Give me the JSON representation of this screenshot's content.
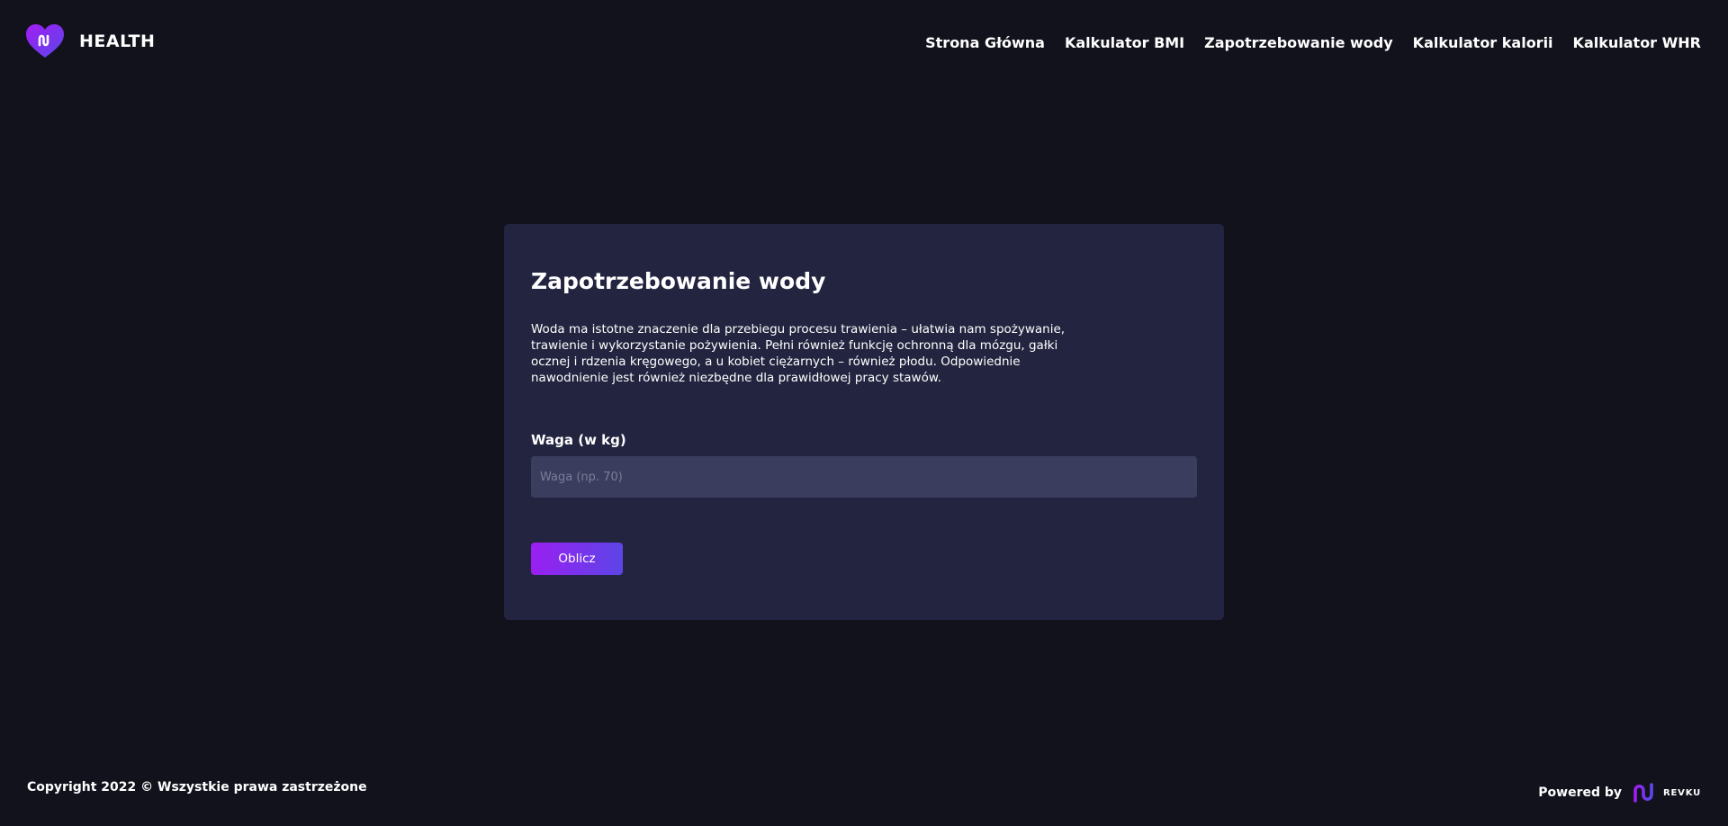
{
  "header": {
    "brand_name": "HEALTH",
    "logo_icon": "heart-logo-icon"
  },
  "nav": {
    "items": [
      {
        "label": "Strona Główna"
      },
      {
        "label": "Kalkulator BMI"
      },
      {
        "label": "Zapotrzebowanie wody"
      },
      {
        "label": "Kalkulator kalorii"
      },
      {
        "label": "Kalkulator WHR"
      }
    ]
  },
  "card": {
    "title": "Zapotrzebowanie wody",
    "description": "Woda ma istotne znaczenie dla przebiegu procesu trawienia – ułatwia nam spożywanie, trawienie i wykorzystanie pożywienia. Pełni również funkcję ochronną dla mózgu, gałki ocznej i rdzenia kręgowego, a u kobiet ciężarnych – również płodu. Odpowiednie nawodnienie jest również niezbędne dla prawidłowej pracy stawów.",
    "weight_label": "Waga (w kg)",
    "weight_placeholder": "Waga (np. 70)",
    "weight_value": "",
    "submit_label": "Oblicz"
  },
  "footer": {
    "copyright": "Copyright 2022 © Wszystkie prawa zastrzeżone",
    "powered_by": "Powered by",
    "powered_brand": "REVKU"
  },
  "colors": {
    "background": "#11121c",
    "card": "#232540",
    "input": "#3b3d5e",
    "accent_start": "#9a1ff2",
    "accent_end": "#5c45e6"
  }
}
